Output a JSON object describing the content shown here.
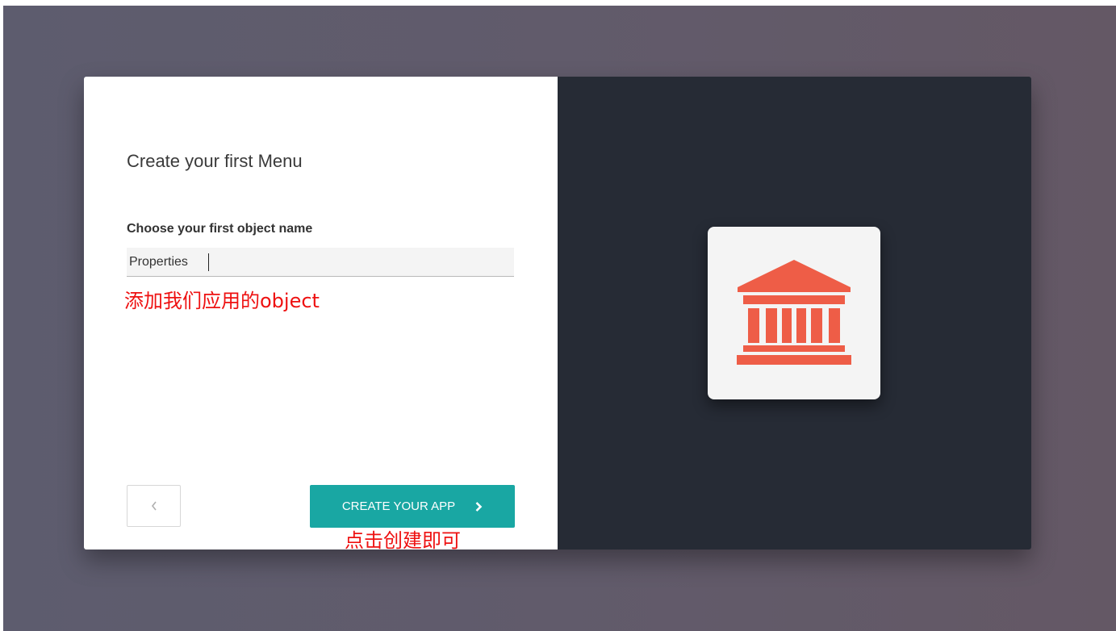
{
  "wizard": {
    "title": "Create your first Menu",
    "object_field": {
      "label": "Choose your first object name",
      "value": "Properties"
    },
    "annotation_object": "添加我们应用的object",
    "back_button": {
      "icon": "chevron-left-icon"
    },
    "create_button": {
      "label": "CREATE YOUR APP",
      "icon": "chevron-right-icon"
    },
    "annotation_create": "点击创建即可"
  },
  "app_icon": {
    "name": "bank-building-icon",
    "color": "#ee5d47"
  },
  "colors": {
    "accent": "#19a7a3",
    "right_panel": "#262b35",
    "annotation": "#ee1111"
  }
}
